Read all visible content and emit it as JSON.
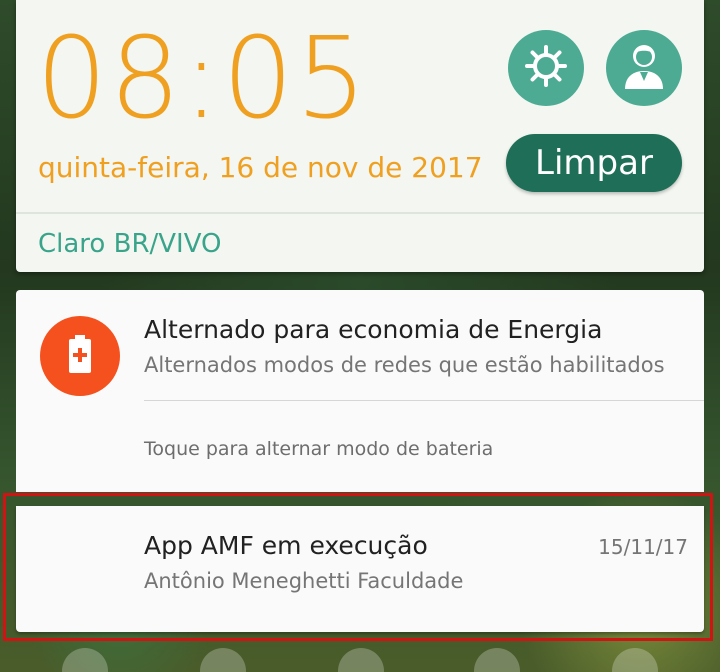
{
  "quick_settings": {
    "clock": "08:05",
    "date": "quinta-feira, 16 de nov de 2017",
    "settings_icon": "gear-icon",
    "user_icon": "user-avatar-icon",
    "clear_button_label": "Limpar",
    "carrier": "Claro BR/VIVO",
    "accent_color": "#f0a020",
    "button_color": "#4dab93",
    "clear_button_color": "#1f6e57"
  },
  "notifications": [
    {
      "icon": "battery-plus-icon",
      "icon_color": "#f4511e",
      "title": "Alternado para economia de Energia",
      "text": "Alternados modos de redes que estão habilitados",
      "action": "Toque para alternar modo de bateria"
    },
    {
      "title": "App AMF em execução",
      "text": "Antônio Meneghetti Faculdade",
      "time": "15/11/17"
    }
  ],
  "highlight_color": "#d01414"
}
